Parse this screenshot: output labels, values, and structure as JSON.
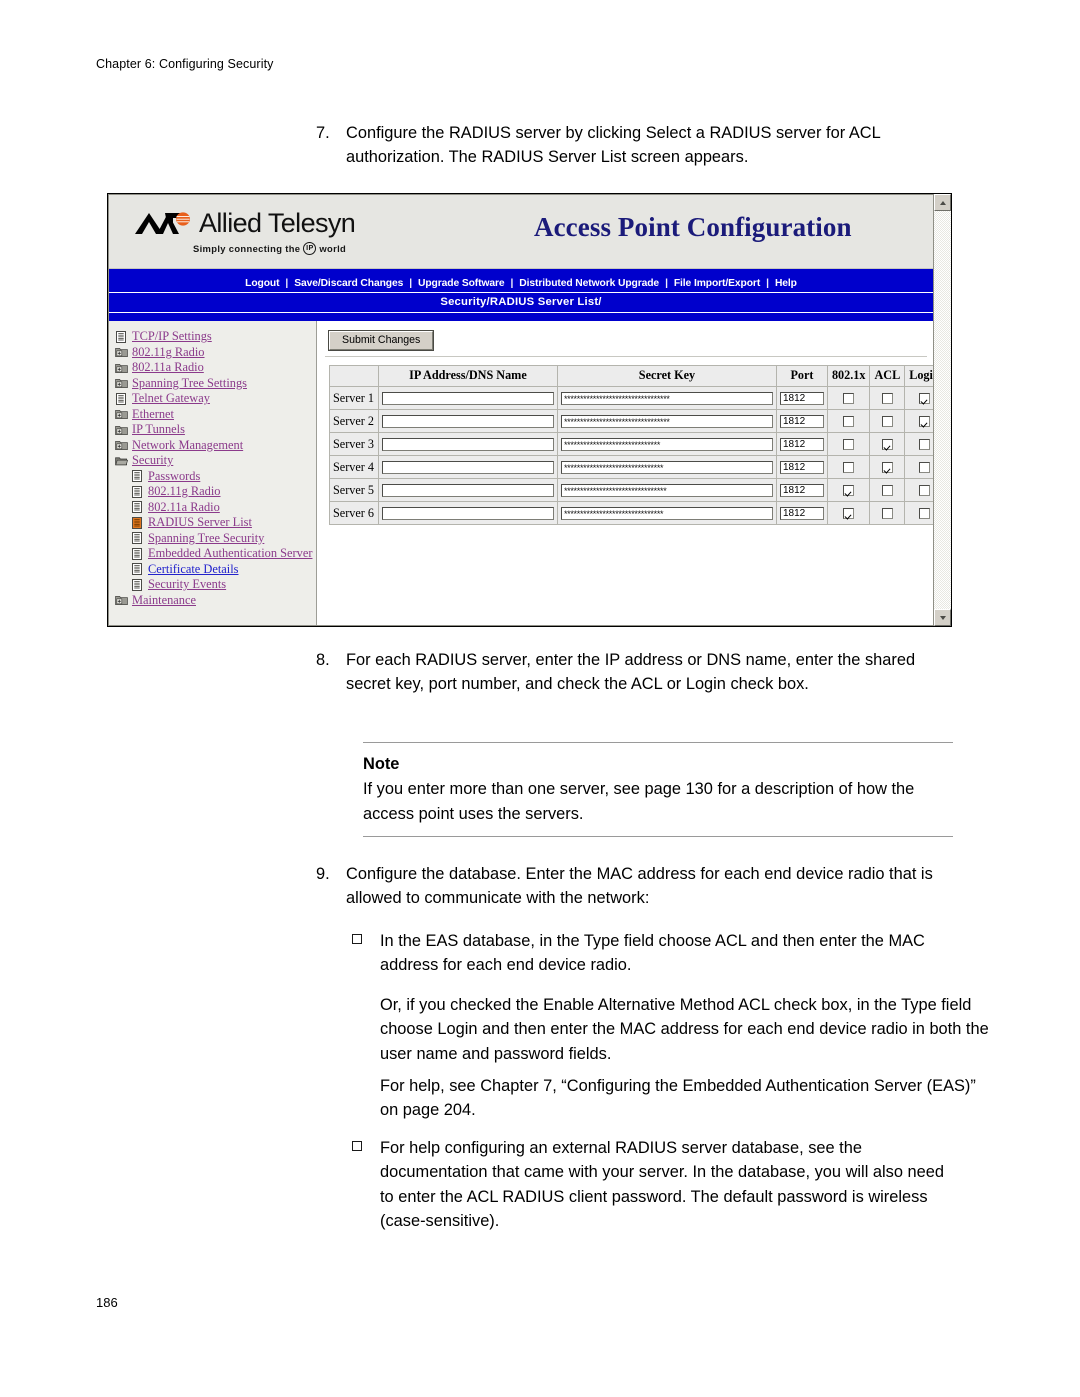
{
  "page": {
    "running_head": "Chapter 6: Configuring Security",
    "folio": "186"
  },
  "steps": {
    "step7": {
      "number": "7.",
      "text": "Configure the RADIUS server by clicking Select a RADIUS server for ACL authorization. The RADIUS Server List screen appears."
    },
    "step8": {
      "number": "8.",
      "text": "For each RADIUS server, enter the IP address or DNS name, enter the shared secret key, port number, and check the ACL or Login check box."
    },
    "step9": {
      "number": "9.",
      "text": "Configure the database. Enter the MAC address for each end device radio that is allowed to communicate with the network:"
    }
  },
  "note": {
    "title": "Note",
    "text": "If you enter more than one server, see page 130 for a description of how the access point uses the servers."
  },
  "bullets": {
    "bullet1": "In the EAS database, in the Type field choose ACL and then enter the MAC address for each end device radio.",
    "bullet2": "For help configuring an external RADIUS server database, see the documentation that came with your server. In the database, you will also need to enter the ACL RADIUS client password. The default password is wireless (case-sensitive)."
  },
  "paragraphs": {
    "or_text": "Or, if you checked the Enable Alternative Method ACL check box, in the Type field choose Login and then enter the MAC address for each end device radio in both the user name and password fields.",
    "help_text": "For help, see Chapter 7,  “Configuring the Embedded Authentication Server (EAS)” on page 204."
  },
  "screenshot": {
    "brand": {
      "name": "Allied Telesyn",
      "tagline_before": "Simply connecting the",
      "tagline_ip": "IP",
      "tagline_after": "world"
    },
    "title": "Access Point Configuration",
    "menu": [
      "Logout",
      "Save/Discard Changes",
      "Upgrade Software",
      "Distributed Network Upgrade",
      "File Import/Export",
      "Help"
    ],
    "breadcrumb": "Security/RADIUS Server List/",
    "sidebar": [
      {
        "label": "TCP/IP Settings",
        "icon": "page-icon",
        "indent": 0,
        "state": "visited"
      },
      {
        "label": "802.11g Radio",
        "icon": "folder-plus-icon",
        "indent": 0,
        "state": "visited"
      },
      {
        "label": "802.11a Radio",
        "icon": "folder-plus-icon",
        "indent": 0,
        "state": "visited"
      },
      {
        "label": "Spanning Tree Settings",
        "icon": "folder-plus-icon",
        "indent": 0,
        "state": "visited"
      },
      {
        "label": "Telnet Gateway",
        "icon": "page-icon",
        "indent": 0,
        "state": "visited"
      },
      {
        "label": "Ethernet",
        "icon": "folder-plus-icon",
        "indent": 0,
        "state": "visited"
      },
      {
        "label": "IP Tunnels",
        "icon": "folder-plus-icon",
        "indent": 0,
        "state": "visited"
      },
      {
        "label": "Network Management",
        "icon": "folder-plus-icon",
        "indent": 0,
        "state": "visited"
      },
      {
        "label": "Security",
        "icon": "folder-open-icon",
        "indent": 0,
        "state": "visited"
      },
      {
        "label": "Passwords",
        "icon": "page-icon",
        "indent": 1,
        "state": "visited"
      },
      {
        "label": "802.11g Radio",
        "icon": "page-icon",
        "indent": 1,
        "state": "visited"
      },
      {
        "label": "802.11a Radio",
        "icon": "page-icon",
        "indent": 1,
        "state": "visited"
      },
      {
        "label": "RADIUS Server List",
        "icon": "page-active-icon",
        "indent": 1,
        "state": "visited"
      },
      {
        "label": "Spanning Tree Security",
        "icon": "page-icon",
        "indent": 1,
        "state": "visited"
      },
      {
        "label": "Embedded Authentication Server",
        "icon": "page-icon",
        "indent": 1,
        "state": "visited"
      },
      {
        "label": "Certificate Details",
        "icon": "page-icon",
        "indent": 1,
        "state": "unvisited"
      },
      {
        "label": "Security Events",
        "icon": "page-icon",
        "indent": 1,
        "state": "visited"
      },
      {
        "label": "Maintenance",
        "icon": "folder-plus-icon",
        "indent": 0,
        "state": "visited"
      }
    ],
    "submit_label": "Submit Changes",
    "table": {
      "headers": [
        "",
        "IP Address/DNS Name",
        "Secret Key",
        "Port",
        "802.1x",
        "ACL",
        "Login"
      ],
      "rows": [
        {
          "label": "Server 1",
          "ip": "",
          "secret": "*********************************",
          "port": "1812",
          "dot1x": false,
          "acl": false,
          "login": true
        },
        {
          "label": "Server 2",
          "ip": "",
          "secret": "*********************************",
          "port": "1812",
          "dot1x": false,
          "acl": false,
          "login": true
        },
        {
          "label": "Server 3",
          "ip": "",
          "secret": "******************************",
          "port": "1812",
          "dot1x": false,
          "acl": true,
          "login": false
        },
        {
          "label": "Server 4",
          "ip": "",
          "secret": "*******************************",
          "port": "1812",
          "dot1x": false,
          "acl": true,
          "login": false
        },
        {
          "label": "Server 5",
          "ip": "",
          "secret": "********************************",
          "port": "1812",
          "dot1x": true,
          "acl": false,
          "login": false
        },
        {
          "label": "Server 6",
          "ip": "",
          "secret": "*******************************",
          "port": "1812",
          "dot1x": true,
          "acl": false,
          "login": false
        }
      ]
    },
    "colors": {
      "nav_blue": "#0000cc",
      "title_blue": "#1b1b7a",
      "link_visited": "#8b3a8b",
      "link_unvisited": "#2222cc",
      "active_icon": "#e07820"
    }
  }
}
